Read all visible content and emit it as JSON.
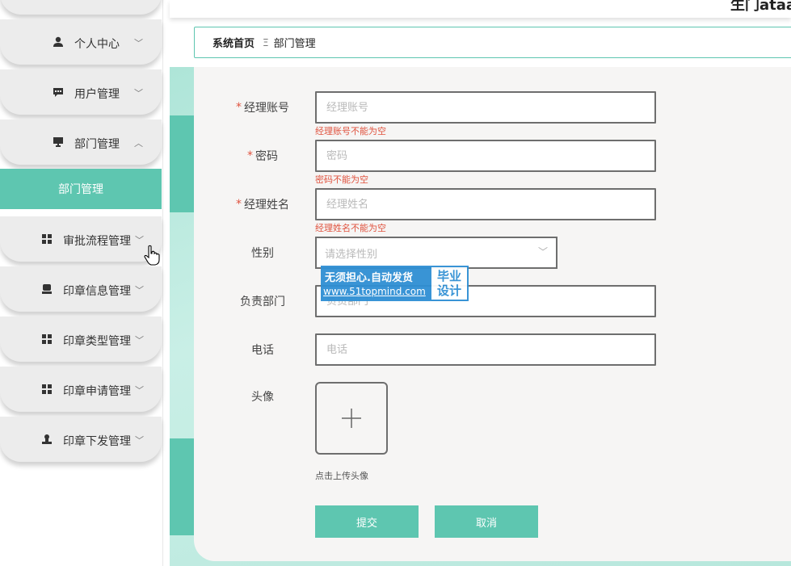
{
  "topbar": {
    "partial_text": "生门ataa"
  },
  "sidebar": {
    "items": [
      {
        "name": "sidebar-item-personal-center",
        "label": "个人中心",
        "icon": "user-icon",
        "chevron": "﹀"
      },
      {
        "name": "sidebar-item-user-management",
        "label": "用户管理",
        "icon": "chat-icon",
        "chevron": "﹀"
      },
      {
        "name": "sidebar-item-department-management",
        "label": "部门管理",
        "icon": "monitor-icon",
        "chevron": "︿"
      },
      {
        "name": "sidebar-item-approval-flow",
        "label": "审批流程管理",
        "icon": "grid-icon",
        "chevron": "﹀"
      },
      {
        "name": "sidebar-item-seal-info",
        "label": "印章信息管理",
        "icon": "seal-icon",
        "chevron": "﹀"
      },
      {
        "name": "sidebar-item-seal-type",
        "label": "印章类型管理",
        "icon": "grid-icon",
        "chevron": "﹀"
      },
      {
        "name": "sidebar-item-seal-application",
        "label": "印章申请管理",
        "icon": "grid-icon",
        "chevron": "﹀"
      },
      {
        "name": "sidebar-item-seal-issuance",
        "label": "印章下发管理",
        "icon": "stamp-icon",
        "chevron": "﹀"
      }
    ],
    "submenu": {
      "label": "部门管理"
    }
  },
  "breadcrumb": {
    "home": "系统首页",
    "separator": "Ξ",
    "current": "部门管理"
  },
  "form": {
    "manager_account": {
      "label": "经理账号",
      "placeholder": "经理账号",
      "error": "经理账号不能为空",
      "required": "*"
    },
    "password": {
      "label": "密码",
      "placeholder": "密码",
      "error": "密码不能为空",
      "required": "*"
    },
    "manager_name": {
      "label": "经理姓名",
      "placeholder": "经理姓名",
      "error": "经理姓名不能为空",
      "required": "*"
    },
    "gender": {
      "label": "性别",
      "placeholder": "请选择性别"
    },
    "department": {
      "label": "负责部门",
      "placeholder": "负责部门"
    },
    "phone": {
      "label": "电话",
      "placeholder": "电话"
    },
    "avatar": {
      "label": "头像",
      "hint": "点击上传头像",
      "plus": "+"
    },
    "submit_label": "提交",
    "cancel_label": "取消"
  },
  "watermark": {
    "line1": "无须担心.自动发货",
    "line2": "www.51topmind.com",
    "badge_top": "毕业",
    "badge_bottom": "设计"
  },
  "colors": {
    "accent": "#5ec6b0",
    "error": "#e0533f",
    "watermark": "#2f8fd4"
  }
}
